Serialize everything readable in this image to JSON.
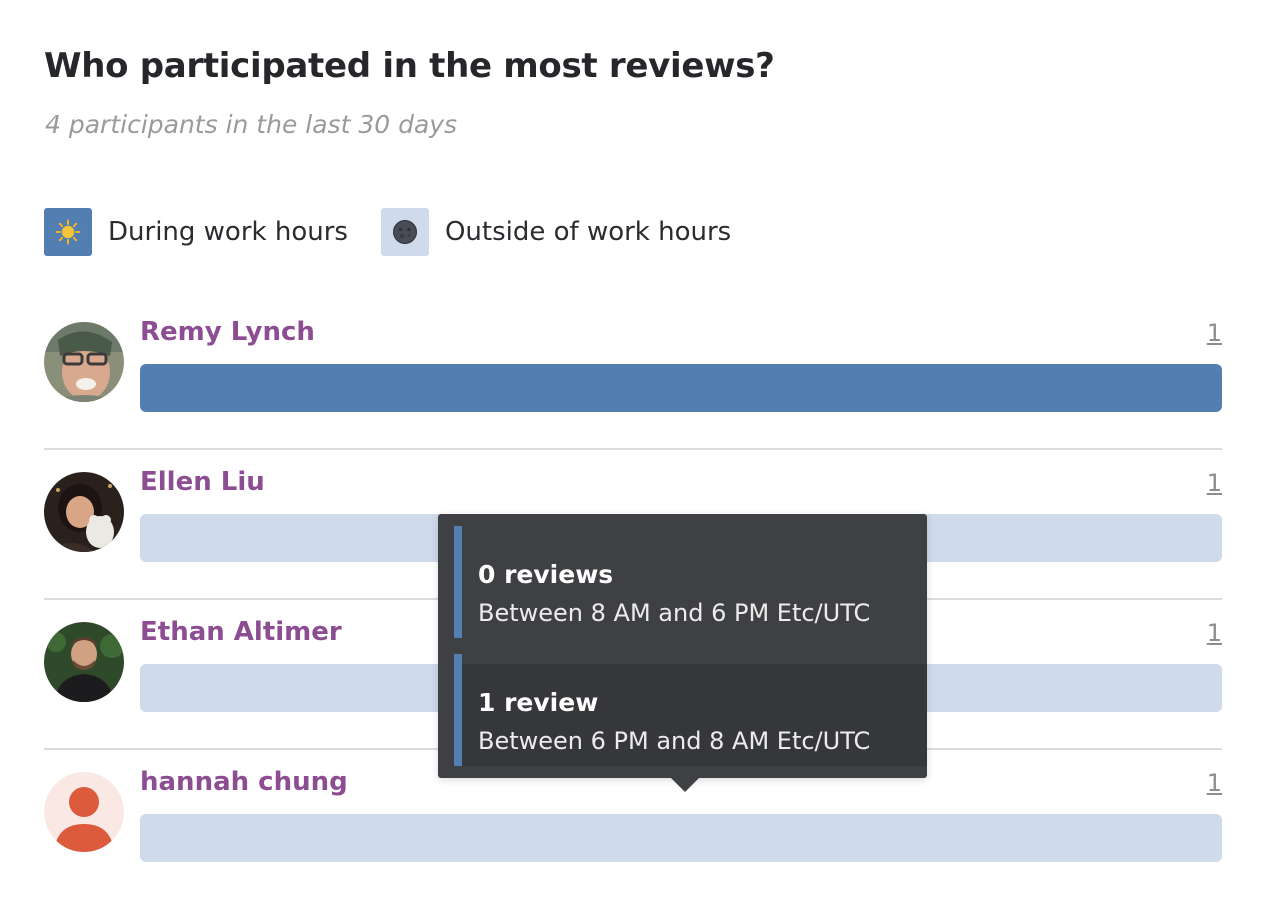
{
  "header": {
    "title": "Who participated in the most reviews?",
    "subtitle": "4 participants in the last 30 days"
  },
  "legend": {
    "items": [
      {
        "label": "During work hours",
        "icon": "sun-icon",
        "color": "#537eb1"
      },
      {
        "label": "Outside of work hours",
        "icon": "moon-icon",
        "color": "#cfdbeb"
      }
    ]
  },
  "participants": [
    {
      "name": "Remy Lynch",
      "count": "1",
      "work_fraction": 1.0,
      "off_fraction": 0.0
    },
    {
      "name": "Ellen Liu",
      "count": "1",
      "work_fraction": 0.0,
      "off_fraction": 1.0
    },
    {
      "name": "Ethan Altimer",
      "count": "1",
      "work_fraction": 0.0,
      "off_fraction": 1.0
    },
    {
      "name": "hannah chung",
      "count": "1",
      "work_fraction": 0.0,
      "off_fraction": 1.0
    }
  ],
  "tooltip": {
    "entries": [
      {
        "count": "0 reviews",
        "range": "Between 8 AM and 6 PM Etc/UTC",
        "color": "#537eb1"
      },
      {
        "count": "1 review",
        "range": "Between 6 PM and 8 AM Etc/UTC",
        "color": "#537eb1"
      }
    ]
  },
  "colors": {
    "work": "#537eb1",
    "offwork": "#cfdbeb",
    "name": "#8c4d93",
    "tooltip_bg": "#3f4043"
  }
}
